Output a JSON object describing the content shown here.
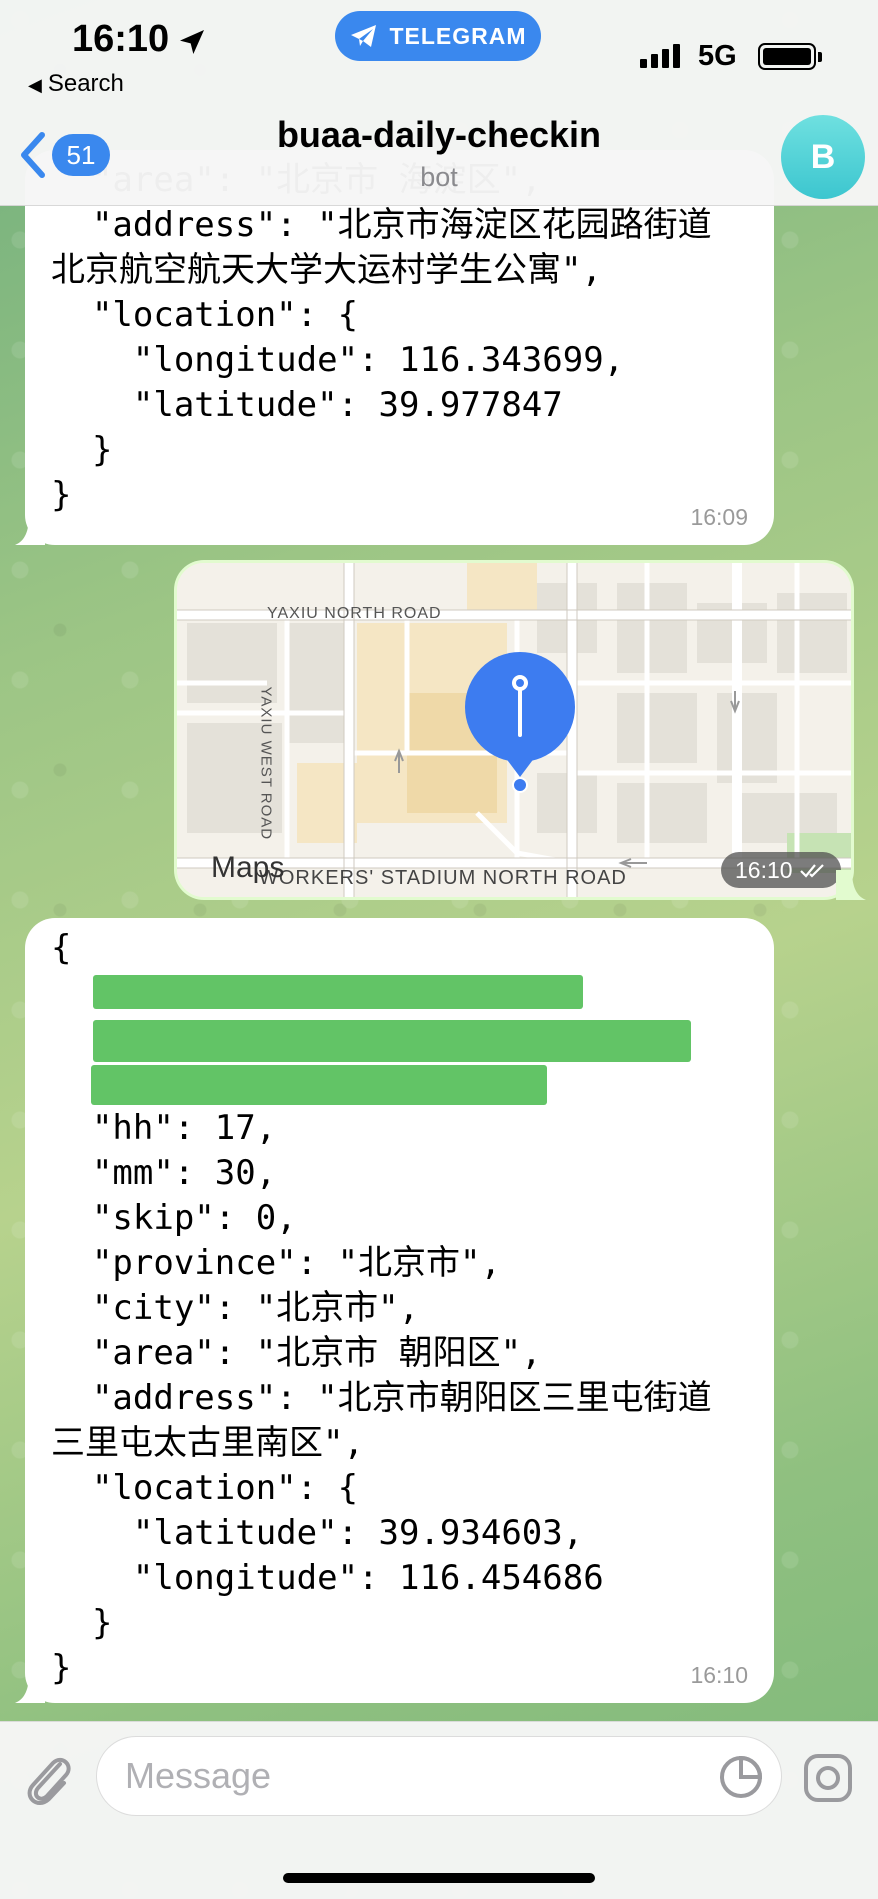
{
  "status_bar": {
    "time": "16:10",
    "back_label": "Search",
    "app_pill": "TELEGRAM",
    "network": "5G"
  },
  "header": {
    "unread_count": "51",
    "title": "buaa-daily-checkin",
    "subtitle": "bot",
    "avatar_letter": "B"
  },
  "messages": [
    {
      "lines": [
        "  \"area\": \"北京市 海淀区\",",
        "  \"address\": \"北京市海淀区花园路街道",
        "北京航空航天大学大运村学生公寓\",",
        "  \"location\": {",
        "    \"longitude\": 116.343699,",
        "    \"latitude\": 39.977847",
        "  }",
        "}"
      ],
      "time": "16:09"
    },
    {
      "type": "map",
      "labels": [
        "YAXIU NORTH ROAD",
        "YAXIU WEST ROAD",
        "WORKERS' STADIUM NORTH ROAD"
      ],
      "provider": "Maps",
      "time": "16:10"
    },
    {
      "lines": [
        "{",
        "",
        "",
        "",
        "  \"hh\": 17,",
        "  \"mm\": 30,",
        "  \"skip\": 0,",
        "  \"province\": \"北京市\",",
        "  \"city\": \"北京市\",",
        "  \"area\": \"北京市 朝阳区\",",
        "  \"address\": \"北京市朝阳区三里屯街道",
        "三里屯太古里南区\",",
        "  \"location\": {",
        "    \"latitude\": 39.934603,",
        "    \"longitude\": 116.454686",
        "  }",
        "}"
      ],
      "time": "16:10"
    }
  ],
  "composer": {
    "placeholder": "Message"
  },
  "colors": {
    "accent": "#3a88ee",
    "redaction": "#62c466",
    "outgoing_bubble": "#e2fbcf"
  }
}
